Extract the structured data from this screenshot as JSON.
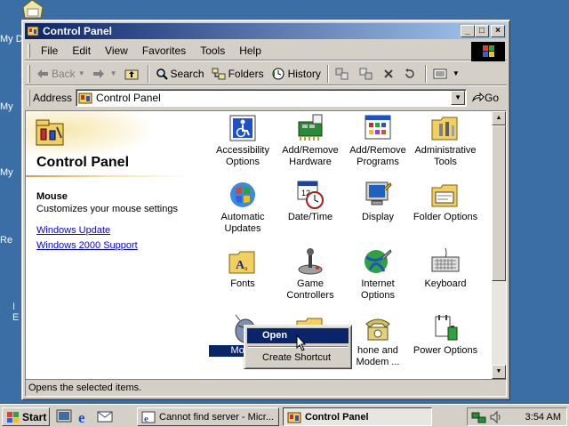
{
  "desktop": {
    "labels": [
      "My D",
      "My",
      "My",
      "Re",
      "I",
      "E"
    ]
  },
  "window": {
    "title": "Control Panel",
    "buttons": [
      "_",
      "□",
      "×"
    ]
  },
  "menubar": [
    "File",
    "Edit",
    "View",
    "Favorites",
    "Tools",
    "Help"
  ],
  "toolbar": {
    "back": "Back",
    "search": "Search",
    "folders": "Folders",
    "history": "History"
  },
  "address": {
    "label": "Address",
    "value": "Control Panel",
    "go": "Go"
  },
  "left_pane": {
    "title": "Control Panel",
    "selected_name": "Mouse",
    "selected_desc": "Customizes your mouse settings",
    "links": [
      "Windows Update",
      "Windows 2000 Support"
    ]
  },
  "items": [
    {
      "label": "Accessibility Options",
      "icon": "accessibility-icon"
    },
    {
      "label": "Add/Remove Hardware",
      "icon": "hardware-icon"
    },
    {
      "label": "Add/Remove Programs",
      "icon": "programs-icon"
    },
    {
      "label": "Administrative Tools",
      "icon": "admin-tools-icon"
    },
    {
      "label": "Automatic Updates",
      "icon": "updates-icon"
    },
    {
      "label": "Date/Time",
      "icon": "datetime-icon"
    },
    {
      "label": "Display",
      "icon": "display-icon"
    },
    {
      "label": "Folder Options",
      "icon": "folder-options-icon"
    },
    {
      "label": "Fonts",
      "icon": "fonts-icon"
    },
    {
      "label": "Game Controllers",
      "icon": "game-controller-icon"
    },
    {
      "label": "Internet Options",
      "icon": "internet-options-icon"
    },
    {
      "label": "Keyboard",
      "icon": "keyboard-icon"
    },
    {
      "label": "Mous",
      "icon": "mouse-icon"
    },
    {
      "label": "",
      "icon": "network-folder-icon"
    },
    {
      "label": "hone and Modem ...",
      "icon": "phone-modem-icon"
    },
    {
      "label": "Power Options",
      "icon": "power-options-icon"
    }
  ],
  "context_menu": {
    "open": "Open",
    "create_shortcut": "Create Shortcut"
  },
  "status": "Opens the selected items.",
  "taskbar": {
    "start": "Start",
    "tasks": [
      "Cannot find server - Micr...",
      "Control Panel"
    ],
    "clock": "3:54 AM"
  },
  "colors": {
    "titlebar_start": "#0a246a",
    "titlebar_end": "#a6caf0",
    "desktop": "#3a6ea5",
    "link": "#0000ff"
  }
}
